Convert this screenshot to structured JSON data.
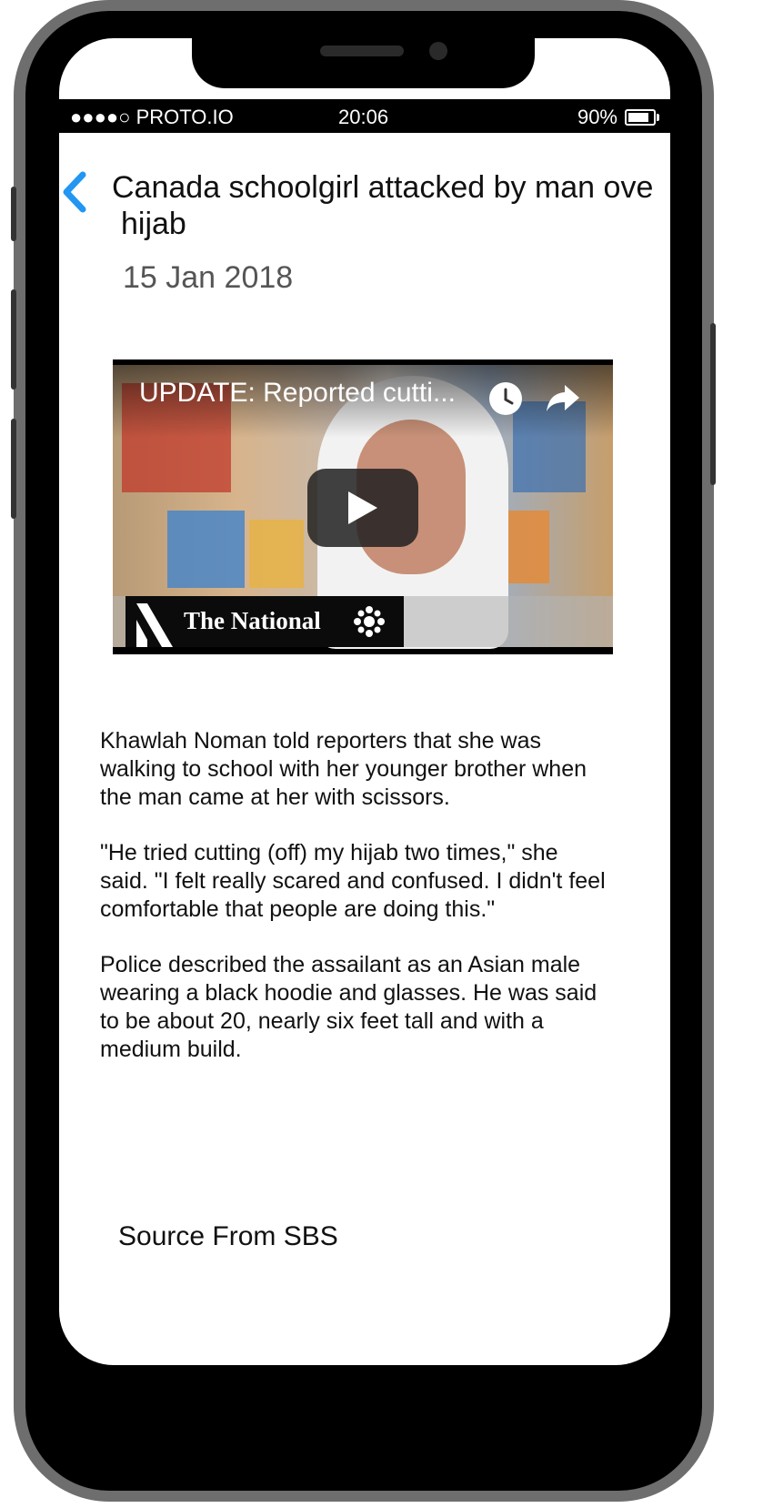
{
  "status_bar": {
    "signal": "●●●●○",
    "carrier": "PROTO.IO",
    "time": "20:06",
    "battery": "90%"
  },
  "article": {
    "title_line1": "Canada schoolgirl attacked by man ove",
    "title_line2": "hijab",
    "date": "15 Jan 2018",
    "paragraphs": [
      "Khawlah Noman told reporters that she was walking to school with her younger brother when the man came at her with scissors.",
      "\"He tried cutting (off) my hijab two times,\" she said. \"I felt really scared and confused. I didn't feel comfortable that people are doing this.\"",
      "Police described the assailant as an Asian male wearing a black hoodie and glasses. He was said to be about 20, nearly six feet tall and with a medium build."
    ],
    "source": "Source From SBS"
  },
  "video": {
    "title": "UPDATE: Reported cutti...",
    "brand": "The National",
    "icons": [
      "watch-later-icon",
      "share-icon",
      "play-icon",
      "cbc-gem-icon"
    ]
  },
  "colors": {
    "accent": "#2196F3",
    "status_bar_bg": "#000000",
    "frame": "#6e6e6e"
  }
}
